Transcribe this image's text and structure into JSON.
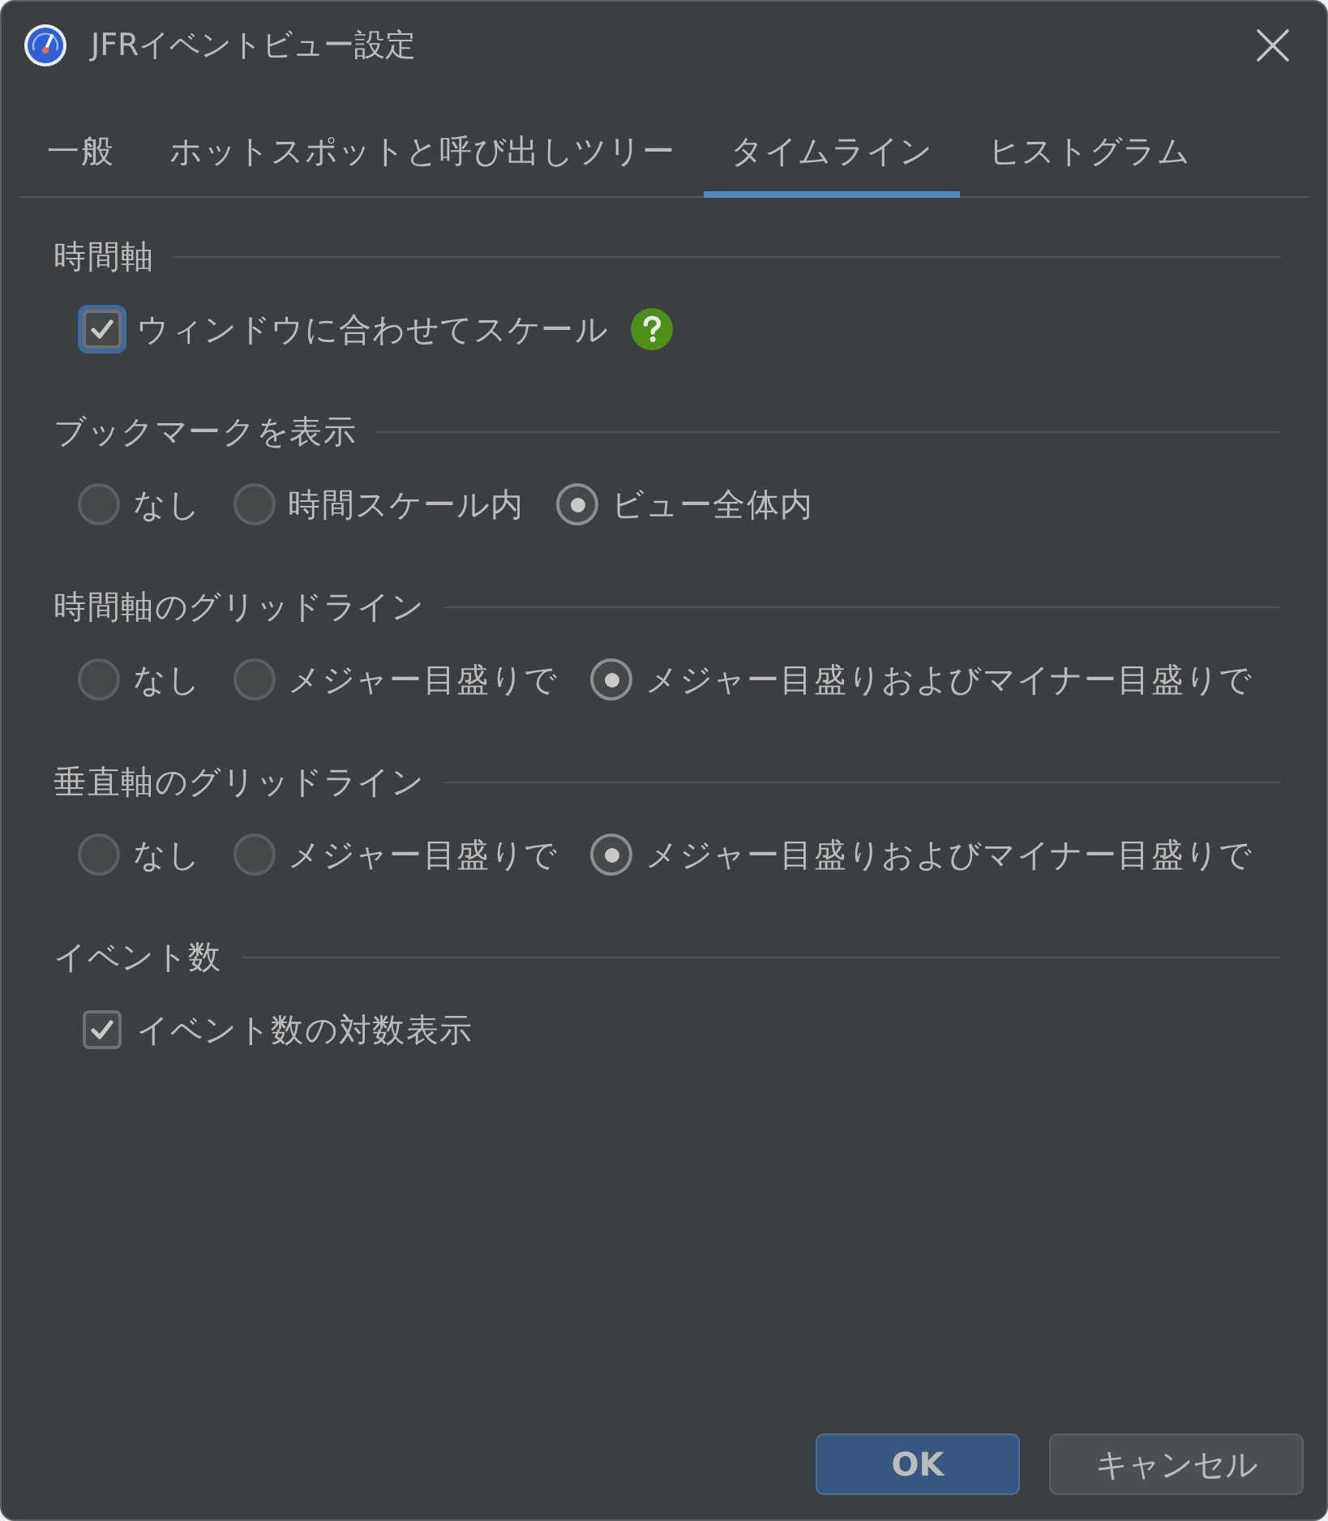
{
  "window": {
    "title": "JFRイベントビュー設定"
  },
  "tabs": [
    {
      "label": "一般",
      "selected": false
    },
    {
      "label": "ホットスポットと呼び出しツリー",
      "selected": false
    },
    {
      "label": "タイムライン",
      "selected": true
    },
    {
      "label": "ヒストグラム",
      "selected": false
    }
  ],
  "sections": [
    {
      "heading": "時間軸",
      "items": [
        {
          "kind": "checkbox",
          "label": "ウィンドウに合わせてスケール",
          "checked": true,
          "focused": true,
          "help": true
        }
      ]
    },
    {
      "heading": "ブックマークを表示",
      "items": [
        {
          "kind": "radio",
          "label": "なし",
          "selected": false
        },
        {
          "kind": "radio",
          "label": "時間スケール内",
          "selected": false
        },
        {
          "kind": "radio",
          "label": "ビュー全体内",
          "selected": true
        }
      ]
    },
    {
      "heading": "時間軸のグリッドライン",
      "items": [
        {
          "kind": "radio",
          "label": "なし",
          "selected": false
        },
        {
          "kind": "radio",
          "label": "メジャー目盛りで",
          "selected": false
        },
        {
          "kind": "radio",
          "label": "メジャー目盛りおよびマイナー目盛りで",
          "selected": true
        }
      ]
    },
    {
      "heading": "垂直軸のグリッドライン",
      "items": [
        {
          "kind": "radio",
          "label": "なし",
          "selected": false
        },
        {
          "kind": "radio",
          "label": "メジャー目盛りで",
          "selected": false
        },
        {
          "kind": "radio",
          "label": "メジャー目盛りおよびマイナー目盛りで",
          "selected": true
        }
      ]
    },
    {
      "heading": "イベント数",
      "items": [
        {
          "kind": "checkbox",
          "label": "イベント数の対数表示",
          "checked": true,
          "focused": false,
          "help": false
        }
      ]
    }
  ],
  "buttons": [
    {
      "label": "OK",
      "default": true
    },
    {
      "label": "キャンセル",
      "default": false
    }
  ]
}
